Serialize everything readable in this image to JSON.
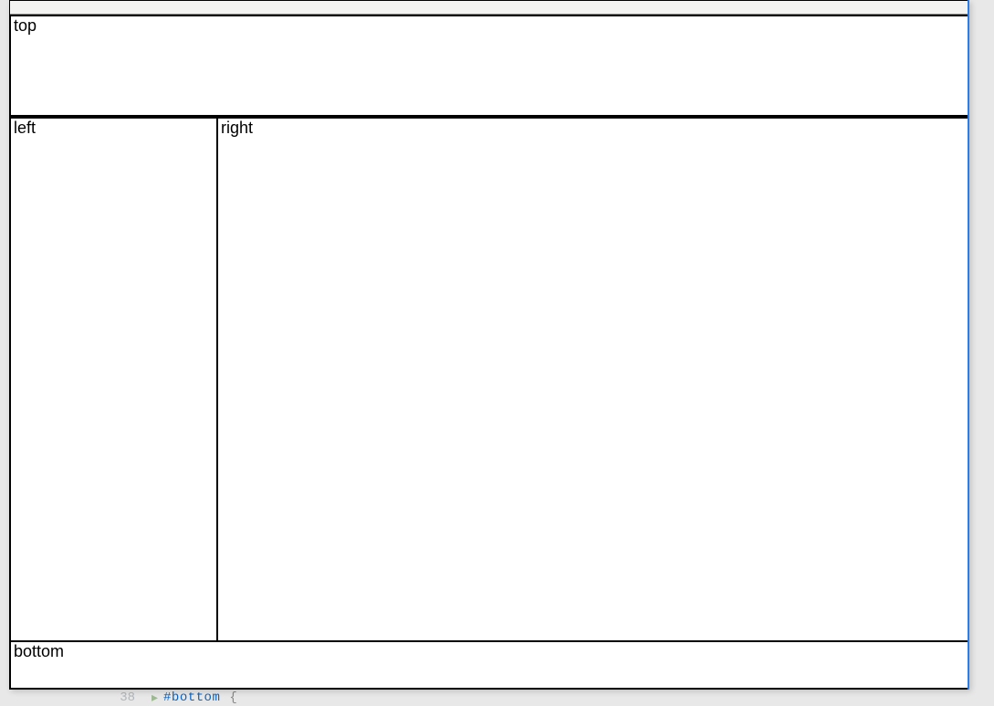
{
  "panels": {
    "top": "top",
    "left": "left",
    "right": "right",
    "bottom": "bottom"
  },
  "editor_peek": {
    "line_number": "38",
    "selector_text": "#bottom",
    "brace": "{"
  }
}
